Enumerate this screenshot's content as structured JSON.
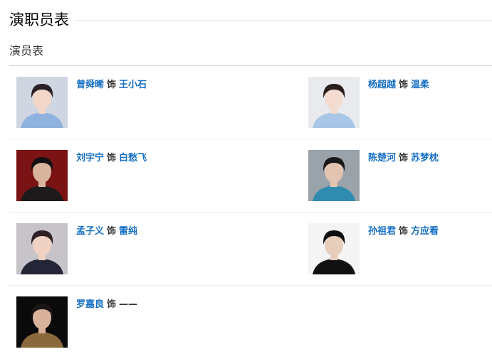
{
  "section": {
    "title": "演职员表",
    "subtitle": "演员表"
  },
  "as_word": "饰",
  "cast": [
    {
      "actor": "曾舜晞",
      "role": "王小石",
      "role_linked": true,
      "photo_bg": "#cfd6e2",
      "clothes": "#8fb2de",
      "hair": "#2a2226",
      "skin": "#f2d6c8"
    },
    {
      "actor": "杨超越",
      "role": "温柔",
      "role_linked": true,
      "photo_bg": "#e8eaee",
      "clothes": "#a8c6e6",
      "hair": "#2b1f1c",
      "skin": "#f3dccf"
    },
    {
      "actor": "刘宇宁",
      "role": "白愁飞",
      "role_linked": true,
      "photo_bg": "#7a1414",
      "clothes": "#1e1a1c",
      "hair": "#141012",
      "skin": "#d9b49c"
    },
    {
      "actor": "陈楚河",
      "role": "苏梦枕",
      "role_linked": true,
      "photo_bg": "#9aa2aa",
      "clothes": "#2f8bb0",
      "hair": "#1a1818",
      "skin": "#e2c4b0"
    },
    {
      "actor": "孟子义",
      "role": "雷纯",
      "role_linked": true,
      "photo_bg": "#c6c3c9",
      "clothes": "#242638",
      "hair": "#2e2024",
      "skin": "#f0d2c4"
    },
    {
      "actor": "孙祖君",
      "role": "方应看",
      "role_linked": true,
      "photo_bg": "#f4f4f4",
      "clothes": "#111111",
      "hair": "#0e0e0e",
      "skin": "#e6cdbc"
    },
    {
      "actor": "罗嘉良",
      "role": "——",
      "role_linked": false,
      "photo_bg": "#0a0a0a",
      "clothes": "#8a6a3c",
      "hair": "#1a1614",
      "skin": "#d8b29a"
    }
  ]
}
